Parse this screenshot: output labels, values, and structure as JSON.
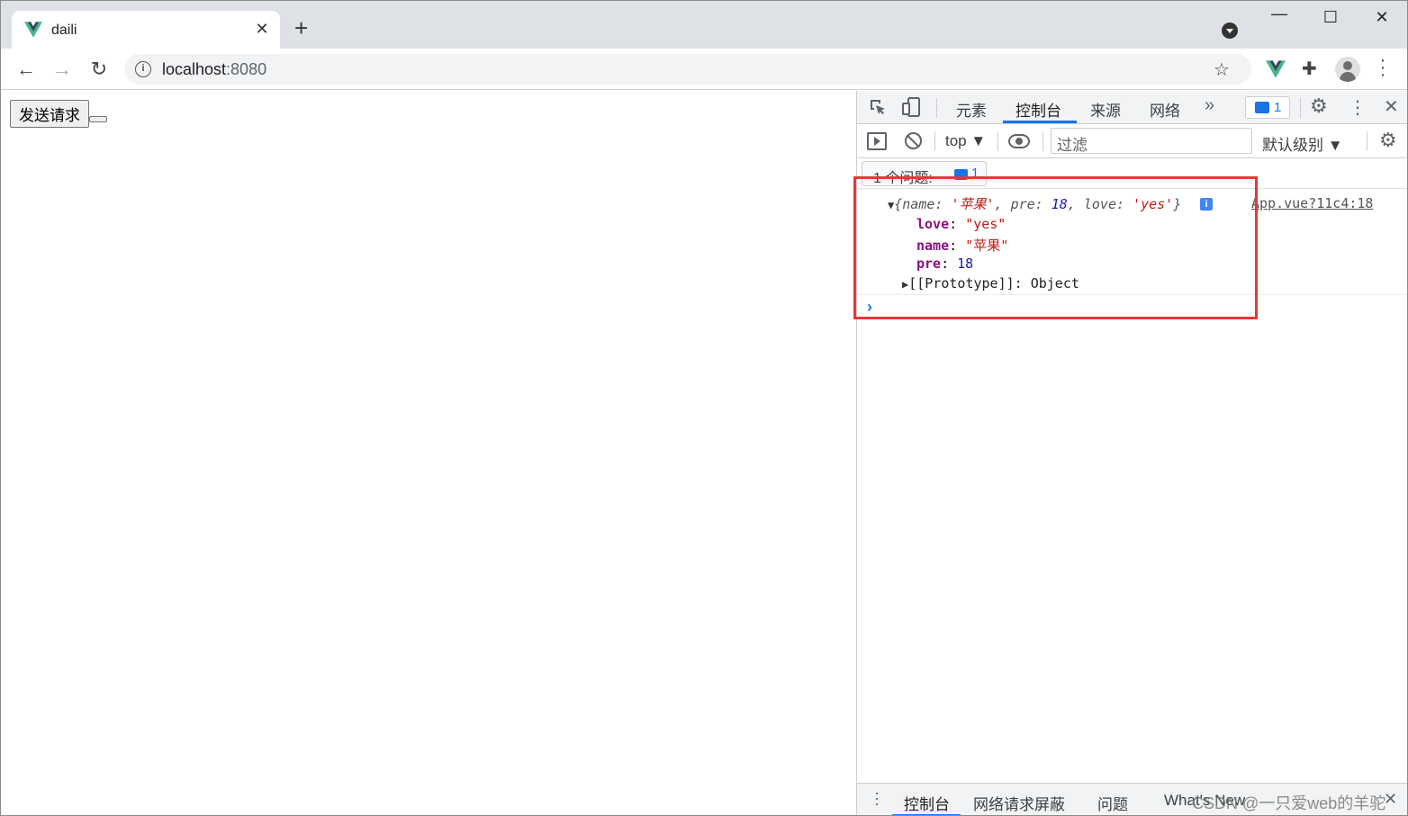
{
  "browser": {
    "tab_title": "daili",
    "url_host": "localhost",
    "url_port": ":8080"
  },
  "page": {
    "send_button_label": "发送请求",
    "empty_button_label": ""
  },
  "devtools": {
    "tabs": [
      "元素",
      "控制台",
      "来源",
      "网络"
    ],
    "issues_badge_count": "1",
    "context": "top ▼",
    "filter_placeholder": "过滤",
    "levels": "默认级别 ▼",
    "issues_bar_text": "1 个问题:",
    "issues_bar_count": "1",
    "console": {
      "summary": {
        "name_key": "name",
        "name_val": "'苹果'",
        "pre_key": "pre",
        "pre_val": "18",
        "love_key": "love",
        "love_val": "'yes'"
      },
      "source": "App.vue?11c4:18",
      "props": [
        {
          "key": "love",
          "value": "\"yes\""
        },
        {
          "key": "name",
          "value": "\"苹果\""
        },
        {
          "key": "pre",
          "value": "18"
        }
      ],
      "prototype_label": "[[Prototype]]",
      "prototype_value": "Object"
    },
    "drawer_tabs": [
      "控制台",
      "网络请求屏蔽",
      "问题",
      "What's New"
    ],
    "watermark": "CSDN @一只爱web的羊驼"
  },
  "colors": {
    "accent": "#1a73e8",
    "highlight_box": "#e53935",
    "vue_green": "#42b883"
  }
}
